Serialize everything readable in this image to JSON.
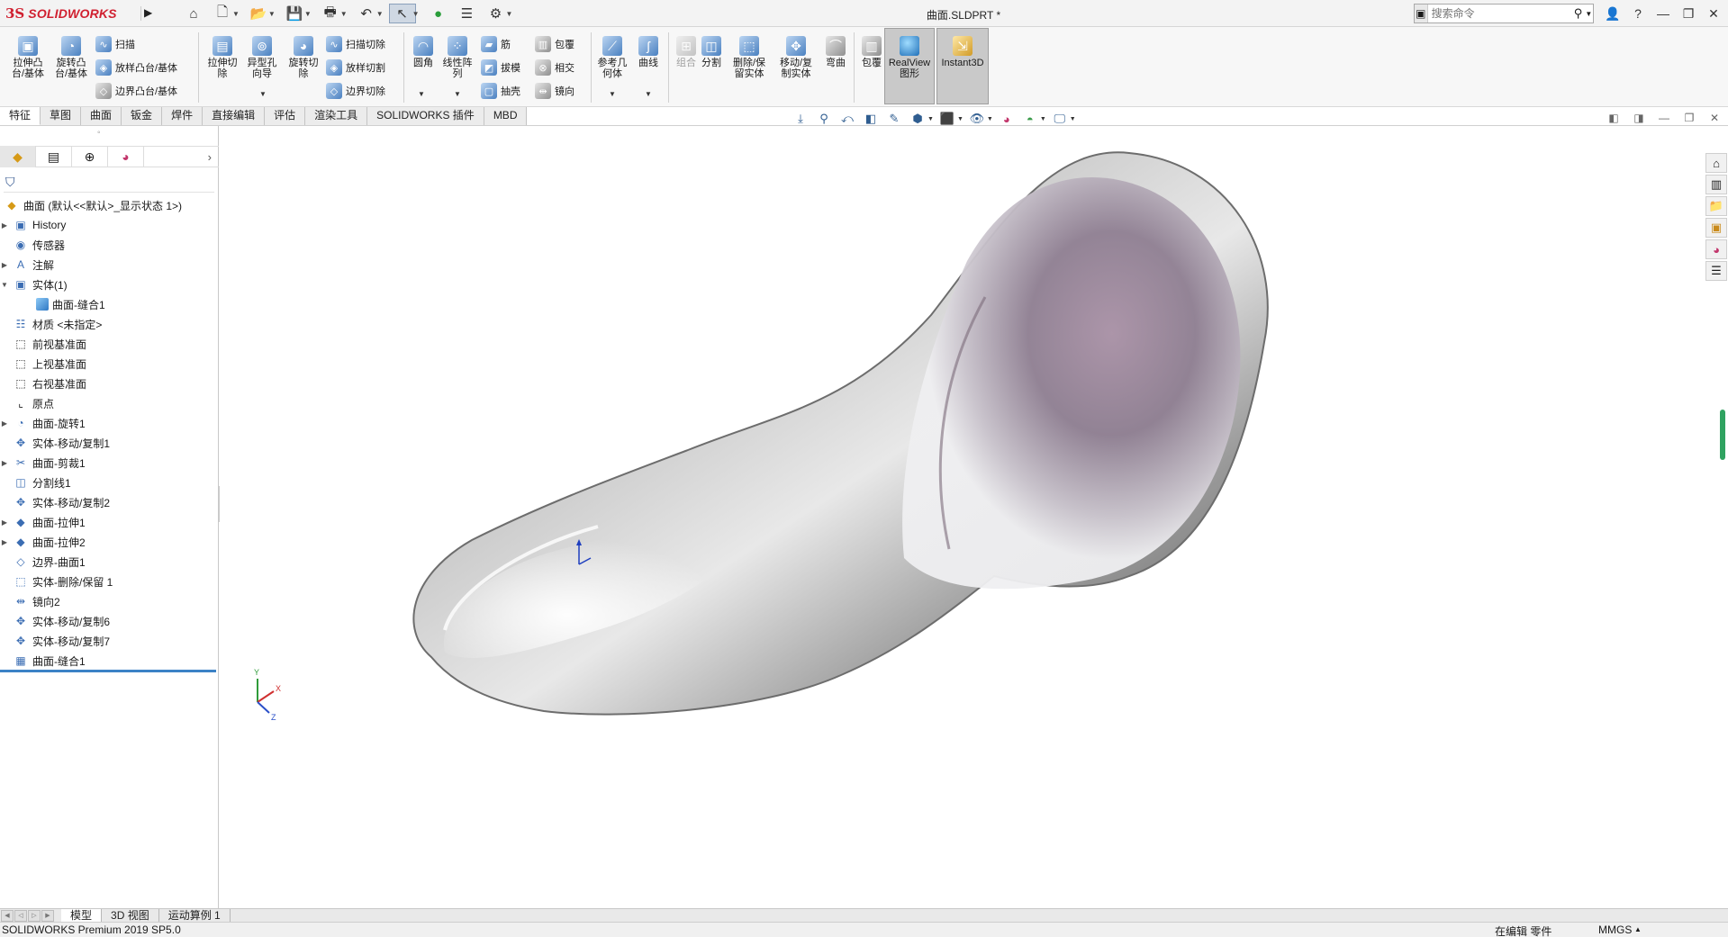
{
  "app": {
    "logo_ds": "3S",
    "logo_text": "SOLIDWORKS",
    "document_title": "曲面.SLDPRT *"
  },
  "search": {
    "placeholder": "搜索命令"
  },
  "command_manager": {
    "features_large": [
      {
        "label": "拉伸凸\n台/基体",
        "icon": "extrude-boss-icon"
      },
      {
        "label": "旋转凸\n台/基体",
        "icon": "revolve-boss-icon"
      }
    ],
    "features_small": [
      {
        "label": "扫描",
        "icon": "sweep-icon"
      },
      {
        "label": "放样凸台/基体",
        "icon": "loft-icon"
      },
      {
        "label": "边界凸台/基体",
        "icon": "boundary-boss-icon"
      }
    ],
    "cut_large": [
      {
        "label": "拉伸切\n除",
        "icon": "extrude-cut-icon"
      },
      {
        "label": "异型孔\n向导",
        "icon": "hole-wizard-icon"
      },
      {
        "label": "旋转切\n除",
        "icon": "revolve-cut-icon"
      }
    ],
    "cut_small": [
      {
        "label": "扫描切除",
        "icon": "sweep-cut-icon"
      },
      {
        "label": "放样切割",
        "icon": "loft-cut-icon"
      },
      {
        "label": "边界切除",
        "icon": "boundary-cut-icon"
      }
    ],
    "fillet": {
      "label": "圆角",
      "icon": "fillet-icon"
    },
    "pattern": {
      "label": "线性阵\n列",
      "icon": "linear-pattern-icon"
    },
    "mid_small": [
      {
        "label": "筋",
        "icon": "rib-icon"
      },
      {
        "label": "拔模",
        "icon": "draft-icon"
      },
      {
        "label": "抽壳",
        "icon": "shell-icon"
      }
    ],
    "right_small": [
      {
        "label": "包覆",
        "icon": "wrap-icon"
      },
      {
        "label": "相交",
        "icon": "intersect-icon"
      },
      {
        "label": "镜向",
        "icon": "mirror-icon"
      }
    ],
    "ref_geometry": {
      "label": "参考几\n何体",
      "icon": "reference-geometry-icon"
    },
    "curves": {
      "label": "曲线",
      "icon": "curves-icon"
    },
    "combine": {
      "label": "组合",
      "icon": "combine-icon"
    },
    "split": {
      "label": "分割",
      "icon": "split-icon"
    },
    "delete_keep": {
      "label": "删除/保\n留实体",
      "icon": "delete-keep-body-icon"
    },
    "move_copy": {
      "label": "移动/复\n制实体",
      "icon": "move-copy-body-icon"
    },
    "flex": {
      "label": "弯曲",
      "icon": "flex-icon"
    },
    "wrap2": {
      "label": "包覆",
      "icon": "wrap-icon"
    },
    "realview": {
      "label": "RealView\n图形",
      "icon": "realview-icon"
    },
    "instant3d": {
      "label": "Instant3D",
      "icon": "instant3d-icon"
    }
  },
  "tabs": [
    {
      "label": "特征",
      "active": true
    },
    {
      "label": "草图"
    },
    {
      "label": "曲面"
    },
    {
      "label": "钣金"
    },
    {
      "label": "焊件"
    },
    {
      "label": "直接编辑"
    },
    {
      "label": "评估"
    },
    {
      "label": "渲染工具"
    },
    {
      "label": "SOLIDWORKS 插件"
    },
    {
      "label": "MBD"
    }
  ],
  "feature_tree": {
    "root": "曲面  (默认<<默认>_显示状态 1>)",
    "items": [
      {
        "label": "History",
        "expandable": true,
        "icon": "history-folder-icon"
      },
      {
        "label": "传感器",
        "expandable": false,
        "icon": "sensors-icon"
      },
      {
        "label": "注解",
        "expandable": true,
        "icon": "annotations-icon"
      },
      {
        "label": "实体(1)",
        "expandable": true,
        "expanded": true,
        "icon": "solid-bodies-icon"
      },
      {
        "label": "曲面-缝合1",
        "expandable": false,
        "child": true,
        "icon": "solid-body-icon"
      },
      {
        "label": "材质 <未指定>",
        "expandable": false,
        "icon": "material-icon"
      },
      {
        "label": "前视基准面",
        "expandable": false,
        "icon": "plane-icon"
      },
      {
        "label": "上视基准面",
        "expandable": false,
        "icon": "plane-icon"
      },
      {
        "label": "右视基准面",
        "expandable": false,
        "icon": "plane-icon"
      },
      {
        "label": "原点",
        "expandable": false,
        "icon": "origin-icon"
      },
      {
        "label": "曲面-旋转1",
        "expandable": true,
        "icon": "surface-revolve-icon"
      },
      {
        "label": "实体-移动/复制1",
        "expandable": false,
        "icon": "move-copy-icon"
      },
      {
        "label": "曲面-剪裁1",
        "expandable": true,
        "icon": "surface-trim-icon"
      },
      {
        "label": "分割线1",
        "expandable": false,
        "icon": "split-line-icon"
      },
      {
        "label": "实体-移动/复制2",
        "expandable": false,
        "icon": "move-copy-icon"
      },
      {
        "label": "曲面-拉伸1",
        "expandable": true,
        "icon": "surface-extrude-icon"
      },
      {
        "label": "曲面-拉伸2",
        "expandable": true,
        "icon": "surface-extrude-icon"
      },
      {
        "label": "边界-曲面1",
        "expandable": false,
        "icon": "boundary-surface-icon"
      },
      {
        "label": "实体-删除/保留 1",
        "expandable": false,
        "icon": "delete-keep-icon"
      },
      {
        "label": "镜向2",
        "expandable": false,
        "icon": "mirror-icon"
      },
      {
        "label": "实体-移动/复制6",
        "expandable": false,
        "icon": "move-copy-icon"
      },
      {
        "label": "实体-移动/复制7",
        "expandable": false,
        "icon": "move-copy-icon"
      },
      {
        "label": "曲面-缝合1",
        "expandable": false,
        "icon": "knit-surface-icon"
      }
    ]
  },
  "bottom_tabs": [
    {
      "label": "模型",
      "active": true
    },
    {
      "label": "3D 视图"
    },
    {
      "label": "运动算例 1"
    }
  ],
  "status": {
    "version": "SOLIDWORKS Premium 2019 SP5.0",
    "editing": "在编辑 零件",
    "units": "MMGS"
  }
}
